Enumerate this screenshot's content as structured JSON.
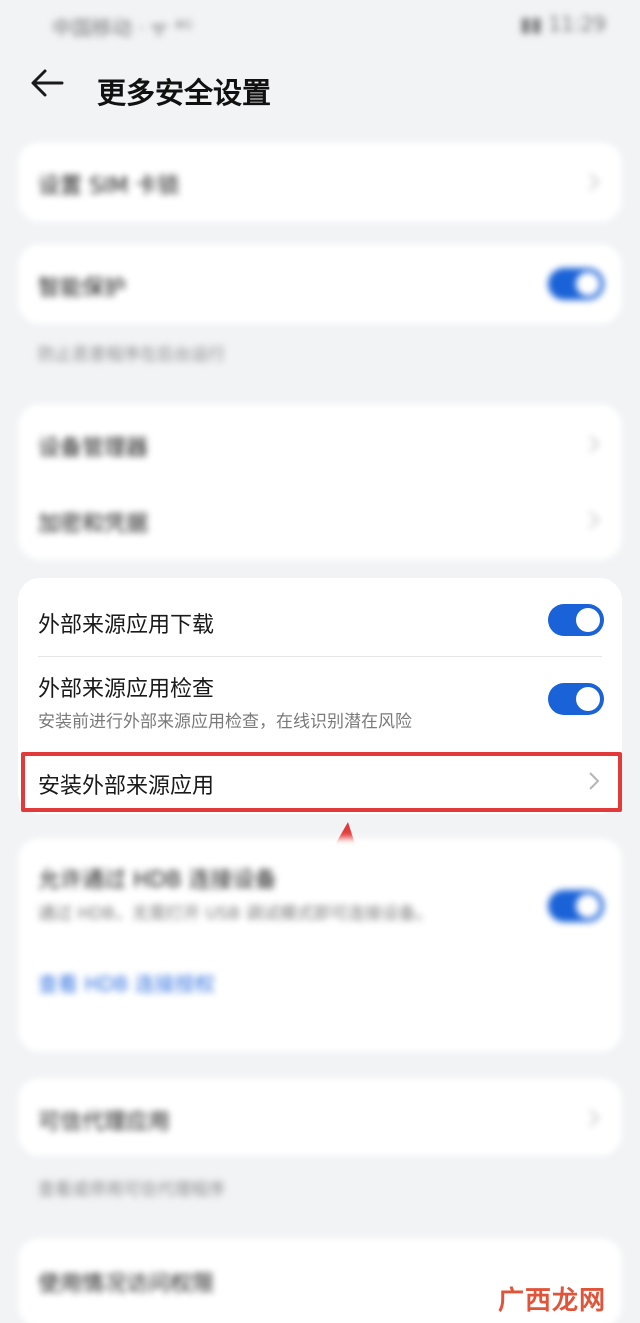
{
  "status_bar": {
    "left_text": "中国移动 ᐧ ᯤ ⁴ᴳ",
    "right_text": "▮▮ 11:29"
  },
  "header": {
    "title": "更多安全设置"
  },
  "blurred": {
    "sim_lock": "设置 SIM 卡锁",
    "smart_protect": "智能保护",
    "smart_protect_note": "防止恶意程序在后台运行",
    "device_admin": "设备管理器",
    "encryption": "加密和凭据",
    "usb_title": "允许通过 HDB 连接设备",
    "usb_sub": "通过 HDB，无需打开 USB 调试模式即可连接设备。",
    "usb_link": "查看 HDB 连接授权",
    "trusted_apps": "可信代理应用",
    "trusted_note": "查看或停用可信代理程序",
    "usage_access": "使用情况访问权限"
  },
  "external_card": {
    "download_label": "外部来源应用下载",
    "check_label": "外部来源应用检查",
    "check_sub": "安装前进行外部来源应用检查，在线识别潜在风险",
    "install_label": "安装外部来源应用"
  },
  "toggles": {
    "smart_protect": true,
    "external_download": true,
    "external_check": true,
    "usb_connect": true
  },
  "colors": {
    "accent": "#1a62d8",
    "highlight": "#e23a3a",
    "background": "#f1f3f5"
  },
  "watermark": "广西龙网"
}
